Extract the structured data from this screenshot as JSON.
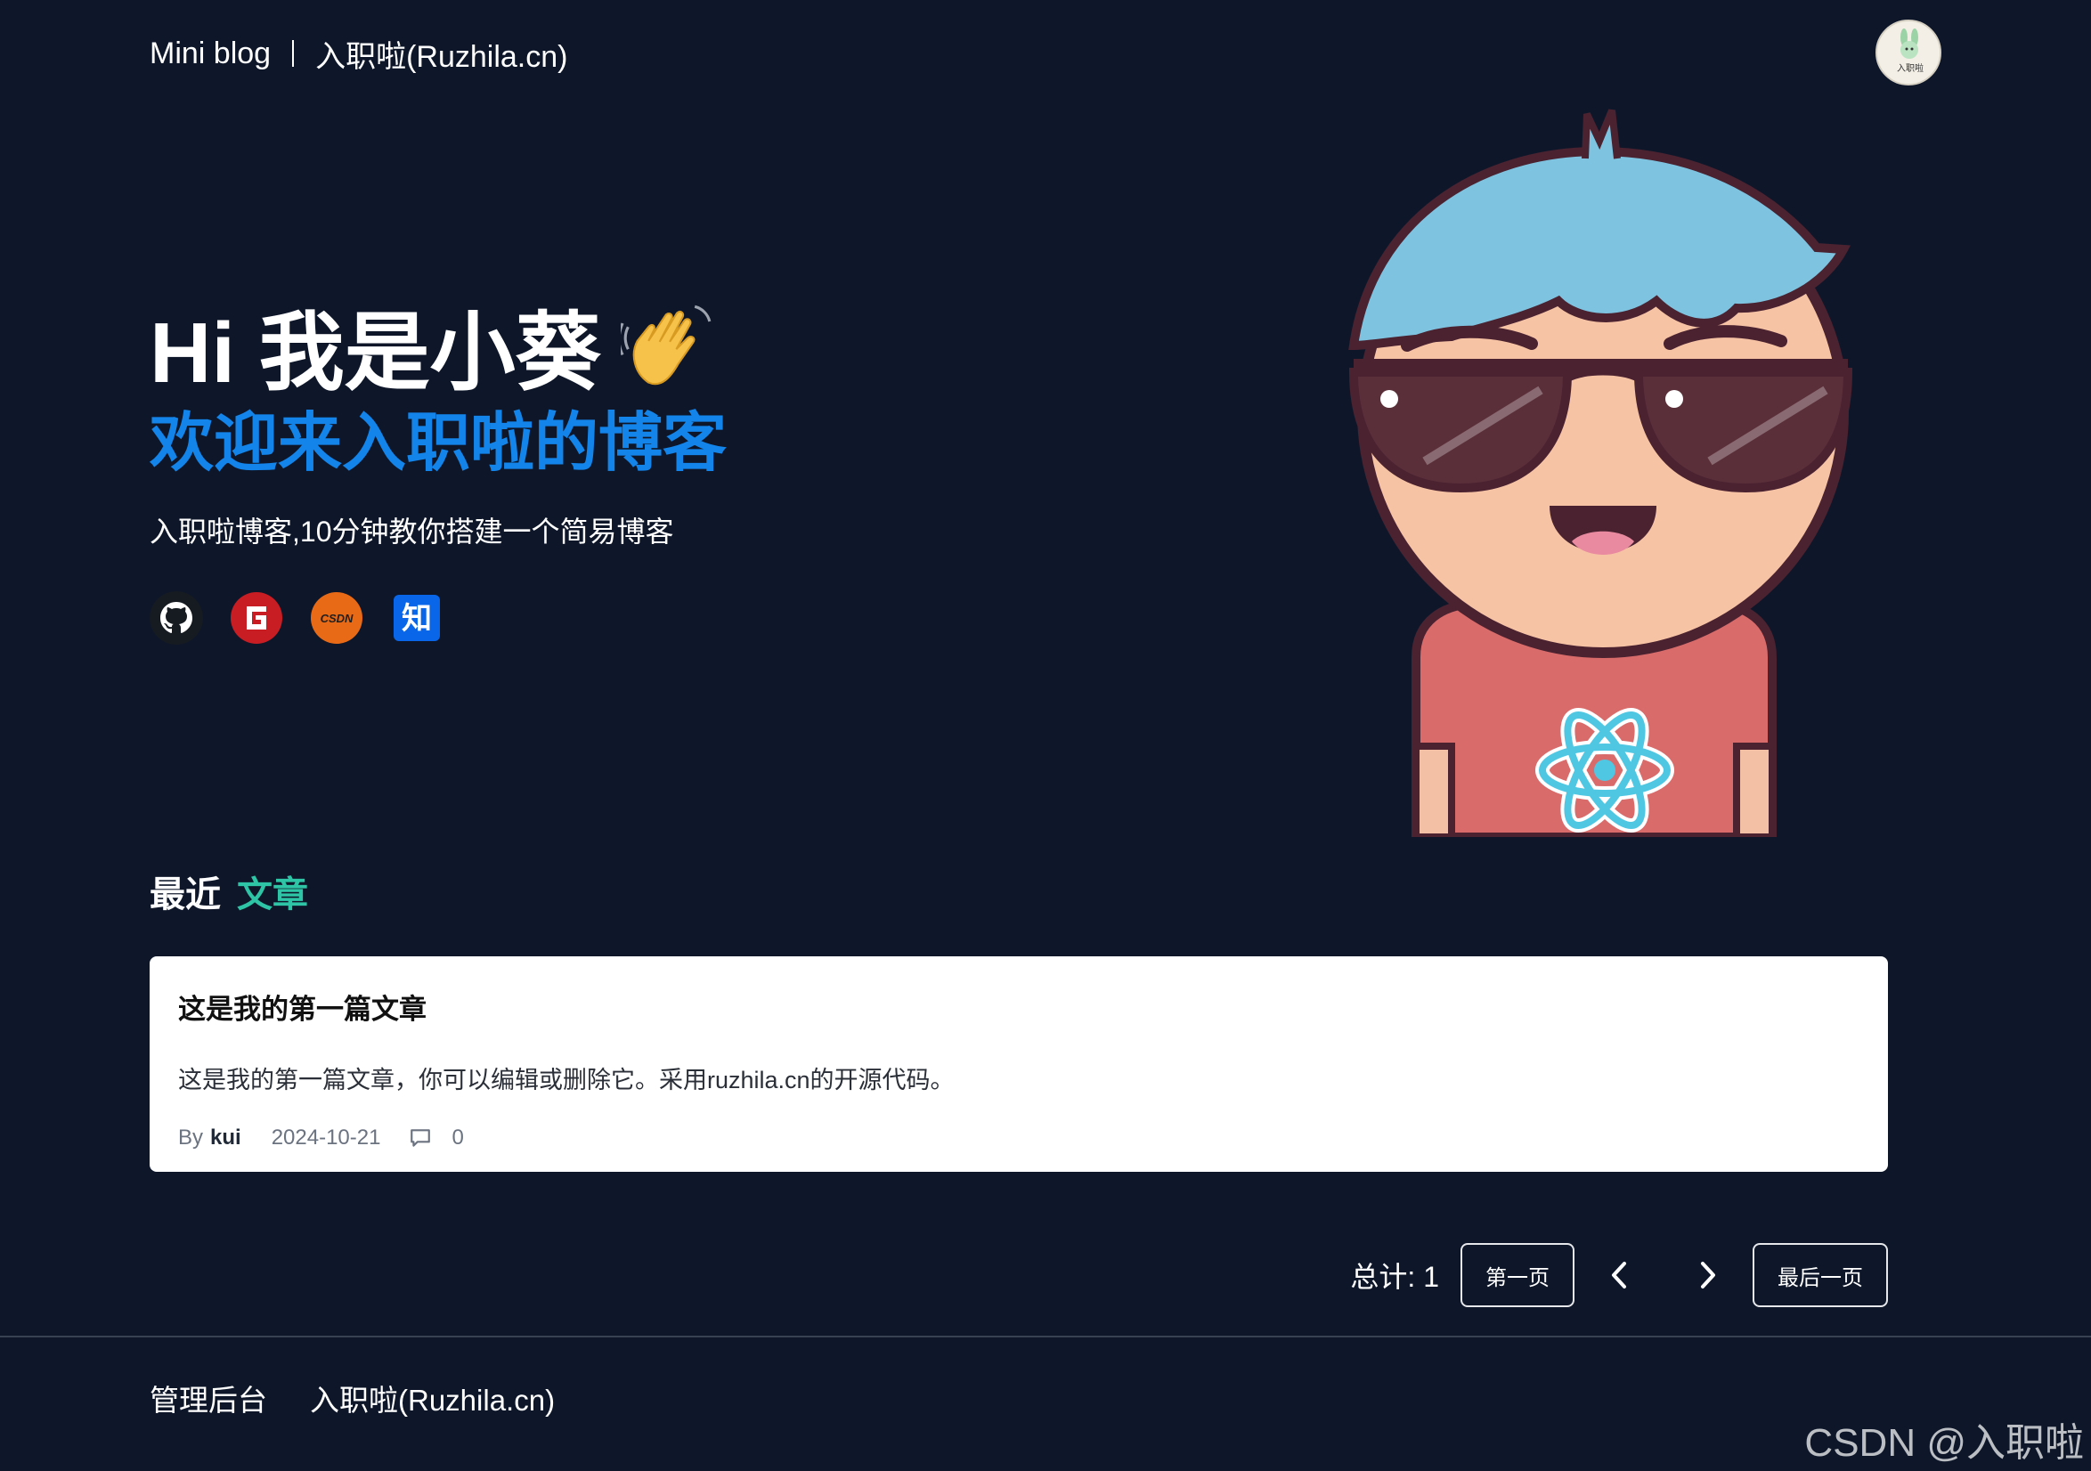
{
  "header": {
    "brand": "Mini blog",
    "site": "入职啦(Ruzhila.cn)",
    "avatar_text": "入职啦"
  },
  "hero": {
    "title": "Hi 我是小葵",
    "wave_icon": "waving-hand-icon",
    "subtitle": "欢迎来入职啦的博客",
    "description": "入职啦博客,10分钟教你搭建一个简易博客",
    "socials": [
      {
        "name": "github-icon"
      },
      {
        "name": "gitee-icon"
      },
      {
        "name": "csdn-icon",
        "text": "CSDN"
      },
      {
        "name": "zhihu-icon",
        "text": "知"
      }
    ]
  },
  "recent": {
    "label": "最近",
    "accent": "文章"
  },
  "posts": [
    {
      "title": "这是我的第一篇文章",
      "excerpt": "这是我的第一篇文章，你可以编辑或删除它。采用ruzhila.cn的开源代码。",
      "by": "By",
      "author": "kui",
      "date": "2024-10-21",
      "comments": "0"
    }
  ],
  "pagination": {
    "total": "总计: 1",
    "first": "第一页",
    "last": "最后一页"
  },
  "footer": {
    "admin": "管理后台",
    "site": "入职啦(Ruzhila.cn)"
  },
  "watermark": "CSDN @入职啦",
  "colors": {
    "background": "#0e172a",
    "accent_blue": "#1384ea",
    "accent_teal": "#2ec4a6"
  }
}
